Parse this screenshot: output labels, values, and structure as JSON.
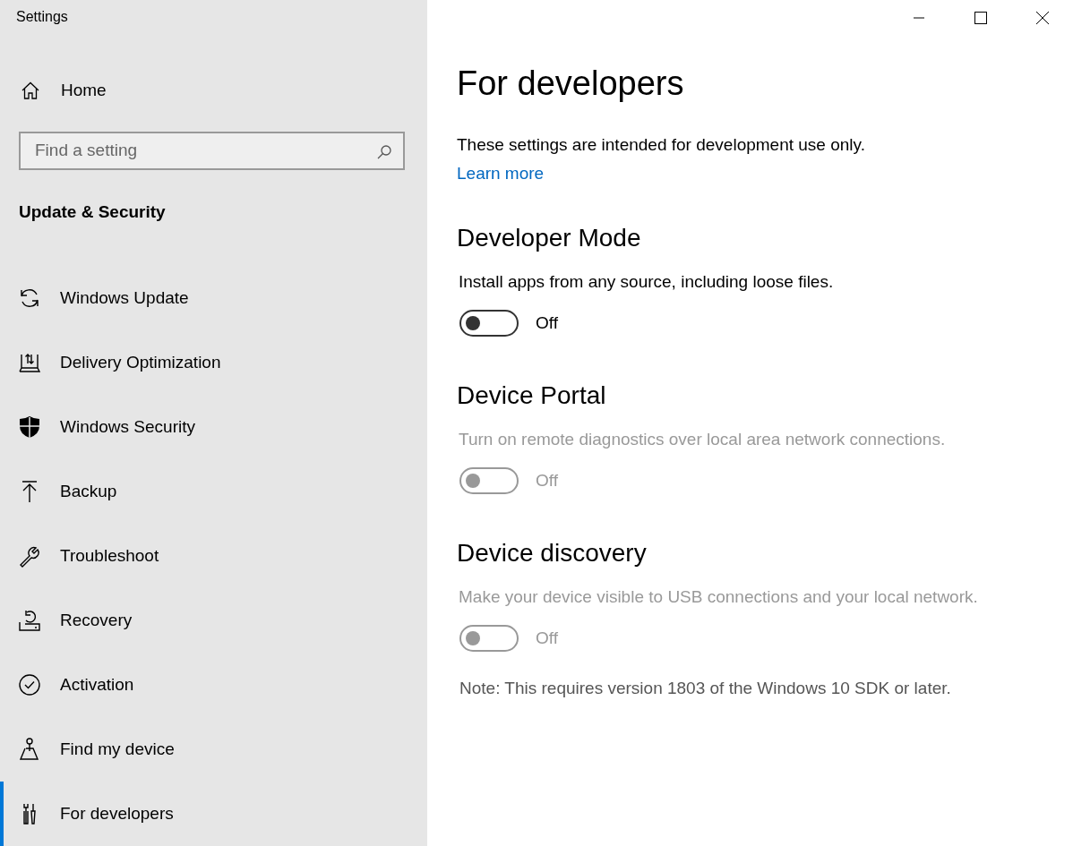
{
  "window": {
    "title": "Settings"
  },
  "sidebar": {
    "home": "Home",
    "search": {
      "placeholder": "Find a setting"
    },
    "section_title": "Update & Security",
    "items": [
      {
        "label": "Windows Update",
        "selected": false
      },
      {
        "label": "Delivery Optimization",
        "selected": false
      },
      {
        "label": "Windows Security",
        "selected": false
      },
      {
        "label": "Backup",
        "selected": false
      },
      {
        "label": "Troubleshoot",
        "selected": false
      },
      {
        "label": "Recovery",
        "selected": false
      },
      {
        "label": "Activation",
        "selected": false
      },
      {
        "label": "Find my device",
        "selected": false
      },
      {
        "label": "For developers",
        "selected": true
      }
    ]
  },
  "page": {
    "title": "For developers",
    "intro": "These settings are intended for development use only.",
    "link": "Learn more",
    "sections": [
      {
        "title": "Developer Mode",
        "description": "Install apps from any source, including loose files.",
        "toggle": {
          "on": false,
          "disabled": false
        },
        "state_label": "Off"
      },
      {
        "title": "Device Portal",
        "description": "Turn on remote diagnostics over local area network connections.",
        "toggle": {
          "on": false,
          "disabled": true
        },
        "state_label": "Off"
      },
      {
        "title": "Device discovery",
        "description": "Make your device visible to USB connections and your local network.",
        "toggle": {
          "on": false,
          "disabled": true
        },
        "state_label": "Off"
      }
    ],
    "note": "Note: This requires version 1803 of the Windows 10 SDK or later."
  }
}
